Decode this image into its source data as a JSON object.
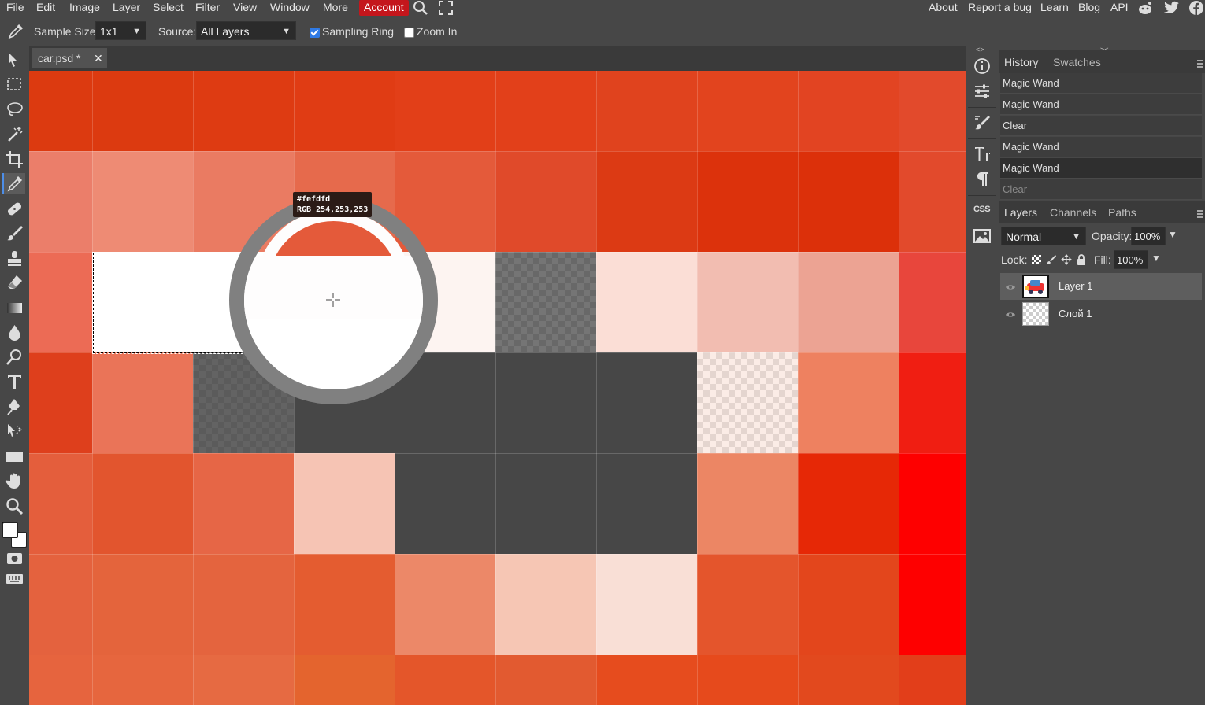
{
  "menubar": {
    "items": [
      "File",
      "Edit",
      "Image",
      "Layer",
      "Select",
      "Filter",
      "View",
      "Window",
      "More",
      "Account"
    ],
    "right_links": [
      "About",
      "Report a bug",
      "Learn",
      "Blog",
      "API"
    ],
    "social_icons": [
      "reddit-icon",
      "twitter-icon",
      "facebook-icon"
    ]
  },
  "options": {
    "sample_size_label": "Sample Size:",
    "sample_size_value": "1x1",
    "source_label": "Source:",
    "source_value": "All Layers",
    "sampling_ring_label": "Sampling Ring",
    "sampling_ring_checked": true,
    "zoom_in_label": "Zoom In",
    "zoom_in_checked": false
  },
  "document": {
    "tab_title": "car.psd *",
    "close_glyph": "✕"
  },
  "color_picker": {
    "hex": "#fefdfd",
    "rgb": "RGB 254,253,253"
  },
  "colors": {
    "accent": "#4d8ee8",
    "account_bg": "#c4161c",
    "foreground": "#ffffff",
    "background": "#ffffff"
  },
  "history_panel": {
    "tabs": [
      "History",
      "Swatches"
    ],
    "items": [
      "Magic Wand",
      "Magic Wand",
      "Clear",
      "Magic Wand",
      "Magic Wand",
      "Clear"
    ],
    "current_index": 4
  },
  "layers_panel": {
    "tabs": [
      "Layers",
      "Channels",
      "Paths"
    ],
    "blend_mode": "Normal",
    "opacity_label": "Opacity:",
    "opacity_value": "100%",
    "lock_label": "Lock:",
    "fill_label": "Fill:",
    "fill_value": "100%",
    "layers": [
      "Layer 1",
      "Слой 1"
    ]
  },
  "right_column_icons": [
    "info-icon",
    "adjustments-icon",
    "brush-settings-icon",
    "character-icon",
    "paragraph-icon",
    "css-icon",
    "image-icon"
  ],
  "css_label": "CSS"
}
